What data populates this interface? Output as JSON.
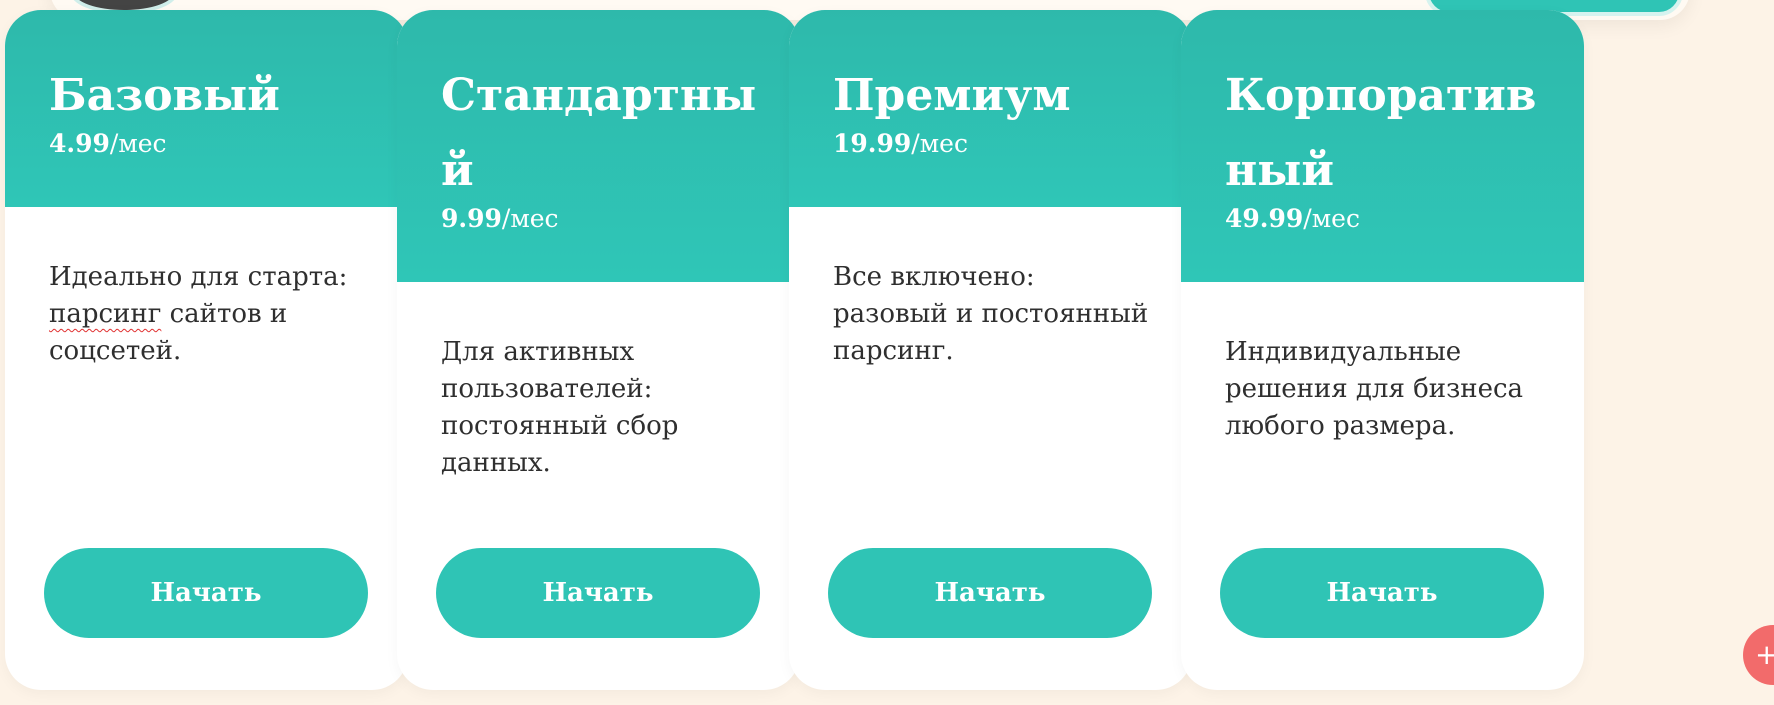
{
  "plans": [
    {
      "title": "Базовый",
      "price": "4.99",
      "period": "/мес",
      "desc_parts": [
        "Идеально для старта: ",
        "парсинг",
        " сайтов и соцсетей."
      ],
      "button": "Начать"
    },
    {
      "title": "Стандартный",
      "price": "9.99",
      "period": "/мес",
      "desc_parts": [
        "Для активных пользователей: постоянный сбор данных."
      ],
      "button": "Начать"
    },
    {
      "title": "Премиум",
      "price": "19.99",
      "period": "/мес",
      "desc_parts": [
        "Все включено:",
        "разовый и постоянный парсинг."
      ],
      "button": "Начать"
    },
    {
      "title": "Корпоративный",
      "price": "49.99",
      "period": "/мес",
      "desc_parts": [
        "Индивидуальные решения для бизнеса любого размера."
      ],
      "button": "Начать"
    }
  ],
  "fab": {
    "icon": "plus-icon",
    "label": "+"
  },
  "colors": {
    "accent": "#2fc4b5",
    "background": "#fdf3e7",
    "fab": "#f26b6b"
  }
}
